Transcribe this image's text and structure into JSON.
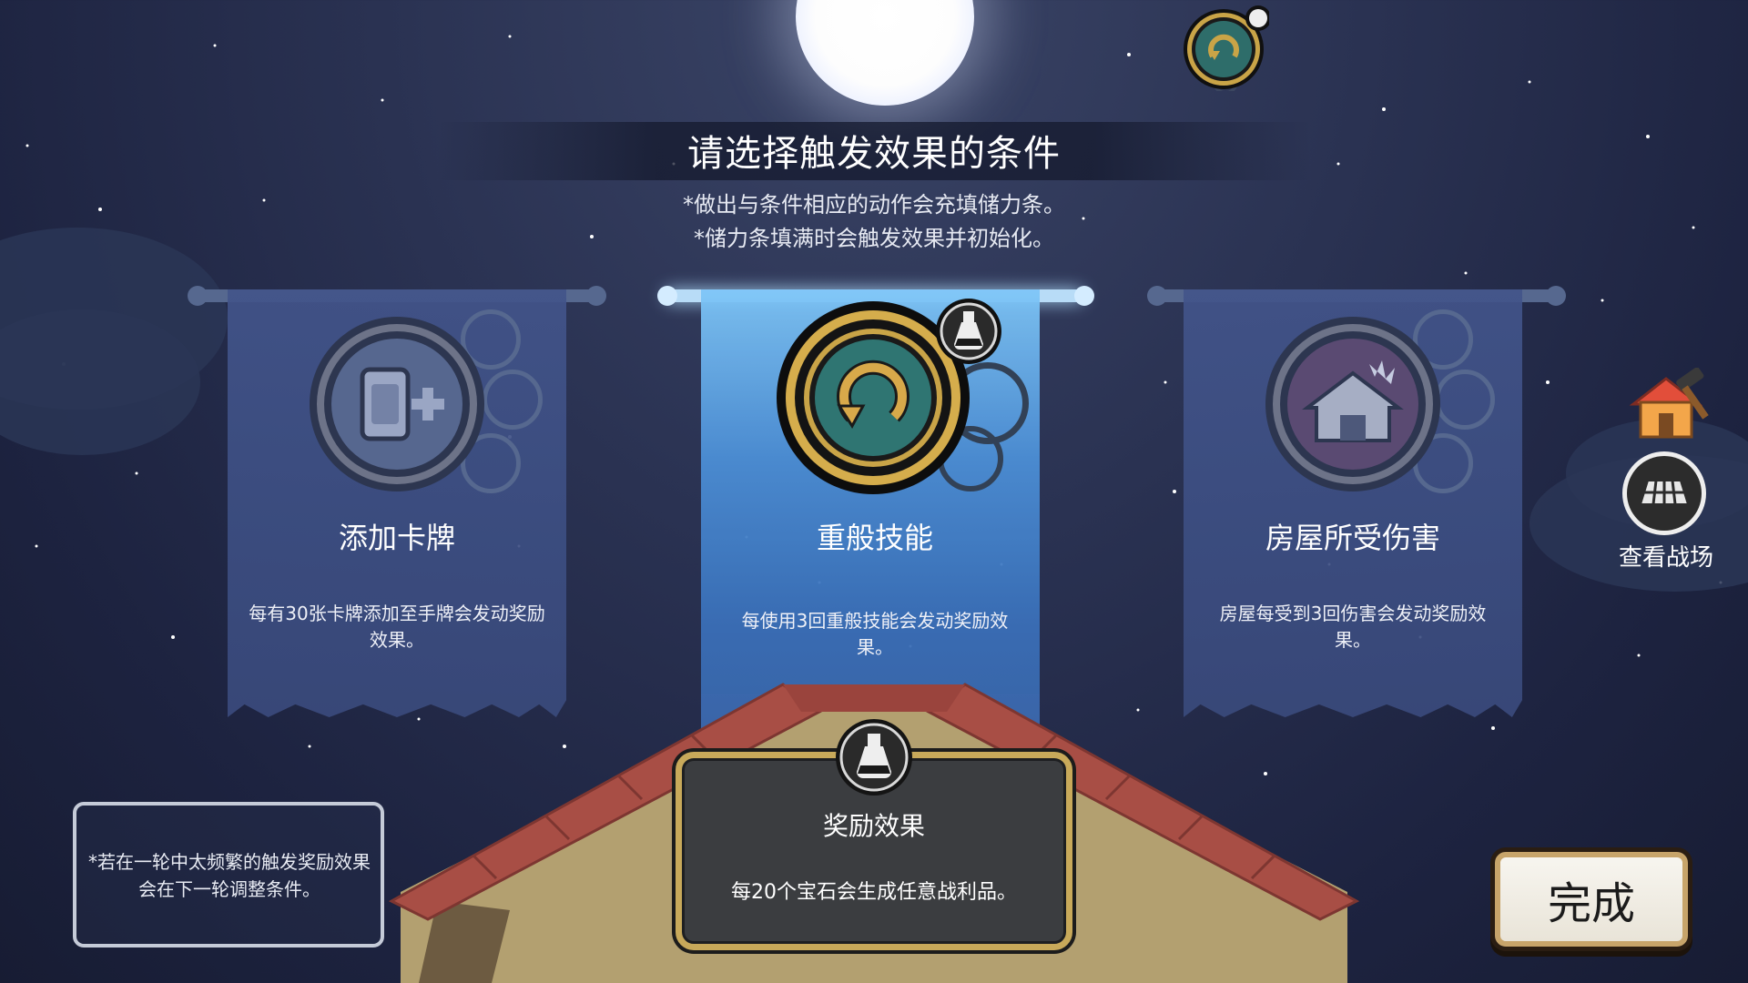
{
  "header": {
    "title": "请选择触发效果的条件",
    "sub1": "*做出与条件相应的动作会充填储力条。",
    "sub2": "*储力条填满时会触发效果并初始化。"
  },
  "cards": [
    {
      "name": "添加卡牌",
      "desc": "每有30张卡牌添加至手牌会发动奖励效果。",
      "icon": "card-plus-icon",
      "selected": false
    },
    {
      "name": "重般技能",
      "desc": "每使用3回重般技能会发动奖励效果。",
      "icon": "refresh-icon",
      "selected": true
    },
    {
      "name": "房屋所受伤害",
      "desc": "房屋每受到3回伤害会发动奖励效果。",
      "icon": "damaged-house-icon",
      "selected": false
    }
  ],
  "bonus": {
    "title": "奖励效果",
    "desc": "每20个宝石会生成任意战利品。",
    "icon": "potion-flask-icon"
  },
  "note": "*若在一轮中太频繁的触发奖励效果会在下一轮调整条件。",
  "done_label": "完成",
  "side": {
    "battlefield_label": "查看战场",
    "house_icon": "house-hammer-icon",
    "battlefield_icon": "battle-grid-icon"
  },
  "colors": {
    "gold": "#c8a95a",
    "selected_glow": "#7fc6f8",
    "banner": "#42548a",
    "background": "#242b48"
  }
}
